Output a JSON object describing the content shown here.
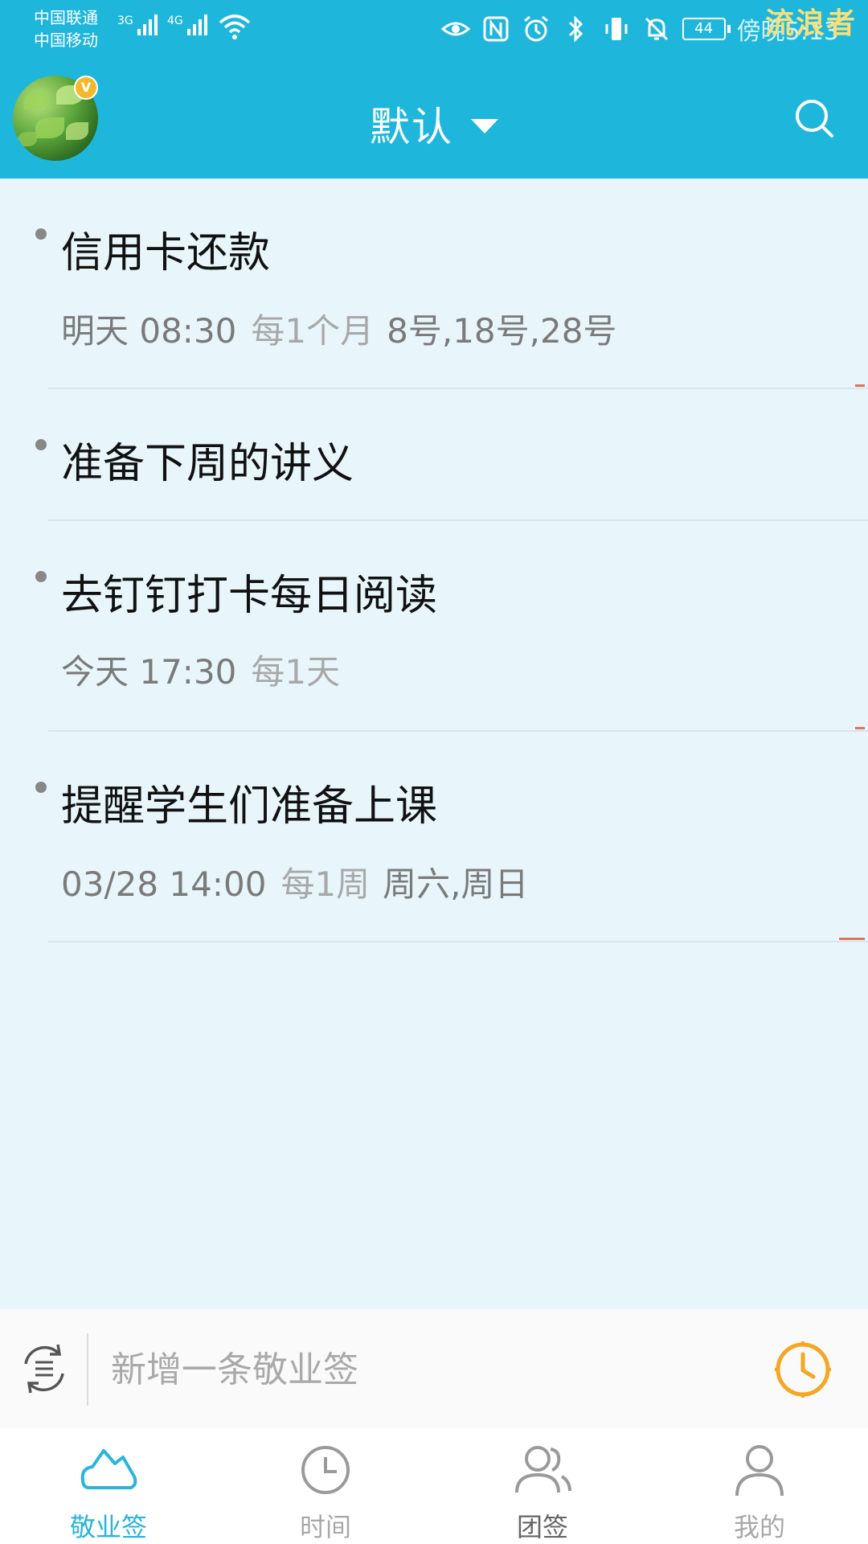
{
  "status_bar": {
    "carrier_1": "中国联通",
    "carrier_2": "中国移动",
    "network_1": "3G",
    "network_2": "4G",
    "battery": "44",
    "time": "傍晚5:13",
    "icons": [
      "eye-icon",
      "nfc-icon",
      "alarm-icon",
      "bluetooth-icon",
      "vibrate-icon",
      "mute-icon"
    ]
  },
  "watermark": "流浪者",
  "app_bar": {
    "vip_badge": "V",
    "title": "默认"
  },
  "items": [
    {
      "title": "信用卡还款",
      "when": "明天 08:30",
      "repeat": "每1个月",
      "days": "8号,18号,28号"
    },
    {
      "title": "准备下周的讲义"
    },
    {
      "title": "去钉钉打卡每日阅读",
      "when": "今天 17:30",
      "repeat": "每1天"
    },
    {
      "title": "提醒学生们准备上课",
      "when": "03/28 14:00",
      "repeat": "每1周",
      "days": "周六,周日"
    }
  ],
  "input": {
    "placeholder": "新增一条敬业签"
  },
  "nav": [
    {
      "label": "敬业签",
      "icon": "note-icon",
      "active": true
    },
    {
      "label": "时间",
      "icon": "clock-icon",
      "active": false
    },
    {
      "label": "团签",
      "icon": "team-icon",
      "active": false
    },
    {
      "label": "我的",
      "icon": "profile-icon",
      "active": false
    }
  ],
  "colors": {
    "header": "#1fb6dc",
    "background": "#e8f6fb",
    "accent": "#2ab4dd",
    "clock_orange": "#f5a623",
    "marker": "#e0735a"
  }
}
